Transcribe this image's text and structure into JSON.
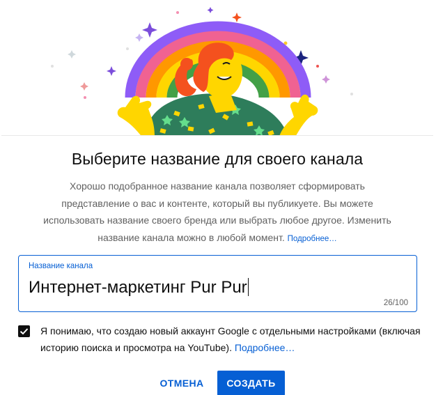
{
  "dialog": {
    "title": "Выберите название для своего канала",
    "description": "Хорошо подобранное название канала позволяет сформировать представление о вас и контенте, который вы публикуете. Вы можете использовать название своего бренда или выбрать любое другое. Изменить название канала можно в любой момент.",
    "learn_more_link": "Подробнее…",
    "channel_name_field": {
      "label": "Название канала",
      "value": "Интернет-маркетинг Pur Pur",
      "counter": "26/100"
    },
    "consent": {
      "checked": true,
      "text": "Я понимаю, что создаю новый аккаунт Google с отдельными настройками (включая историю поиска и просмотра на YouTube).",
      "link": "Подробнее…"
    },
    "buttons": {
      "cancel": "ОТМЕНА",
      "create": "СОЗДАТЬ"
    }
  },
  "colors": {
    "accent": "#065fd4",
    "text_primary": "#0f0f0f",
    "text_secondary": "#606060"
  },
  "illustration": {
    "icon": "rainbow-person-illustration"
  }
}
